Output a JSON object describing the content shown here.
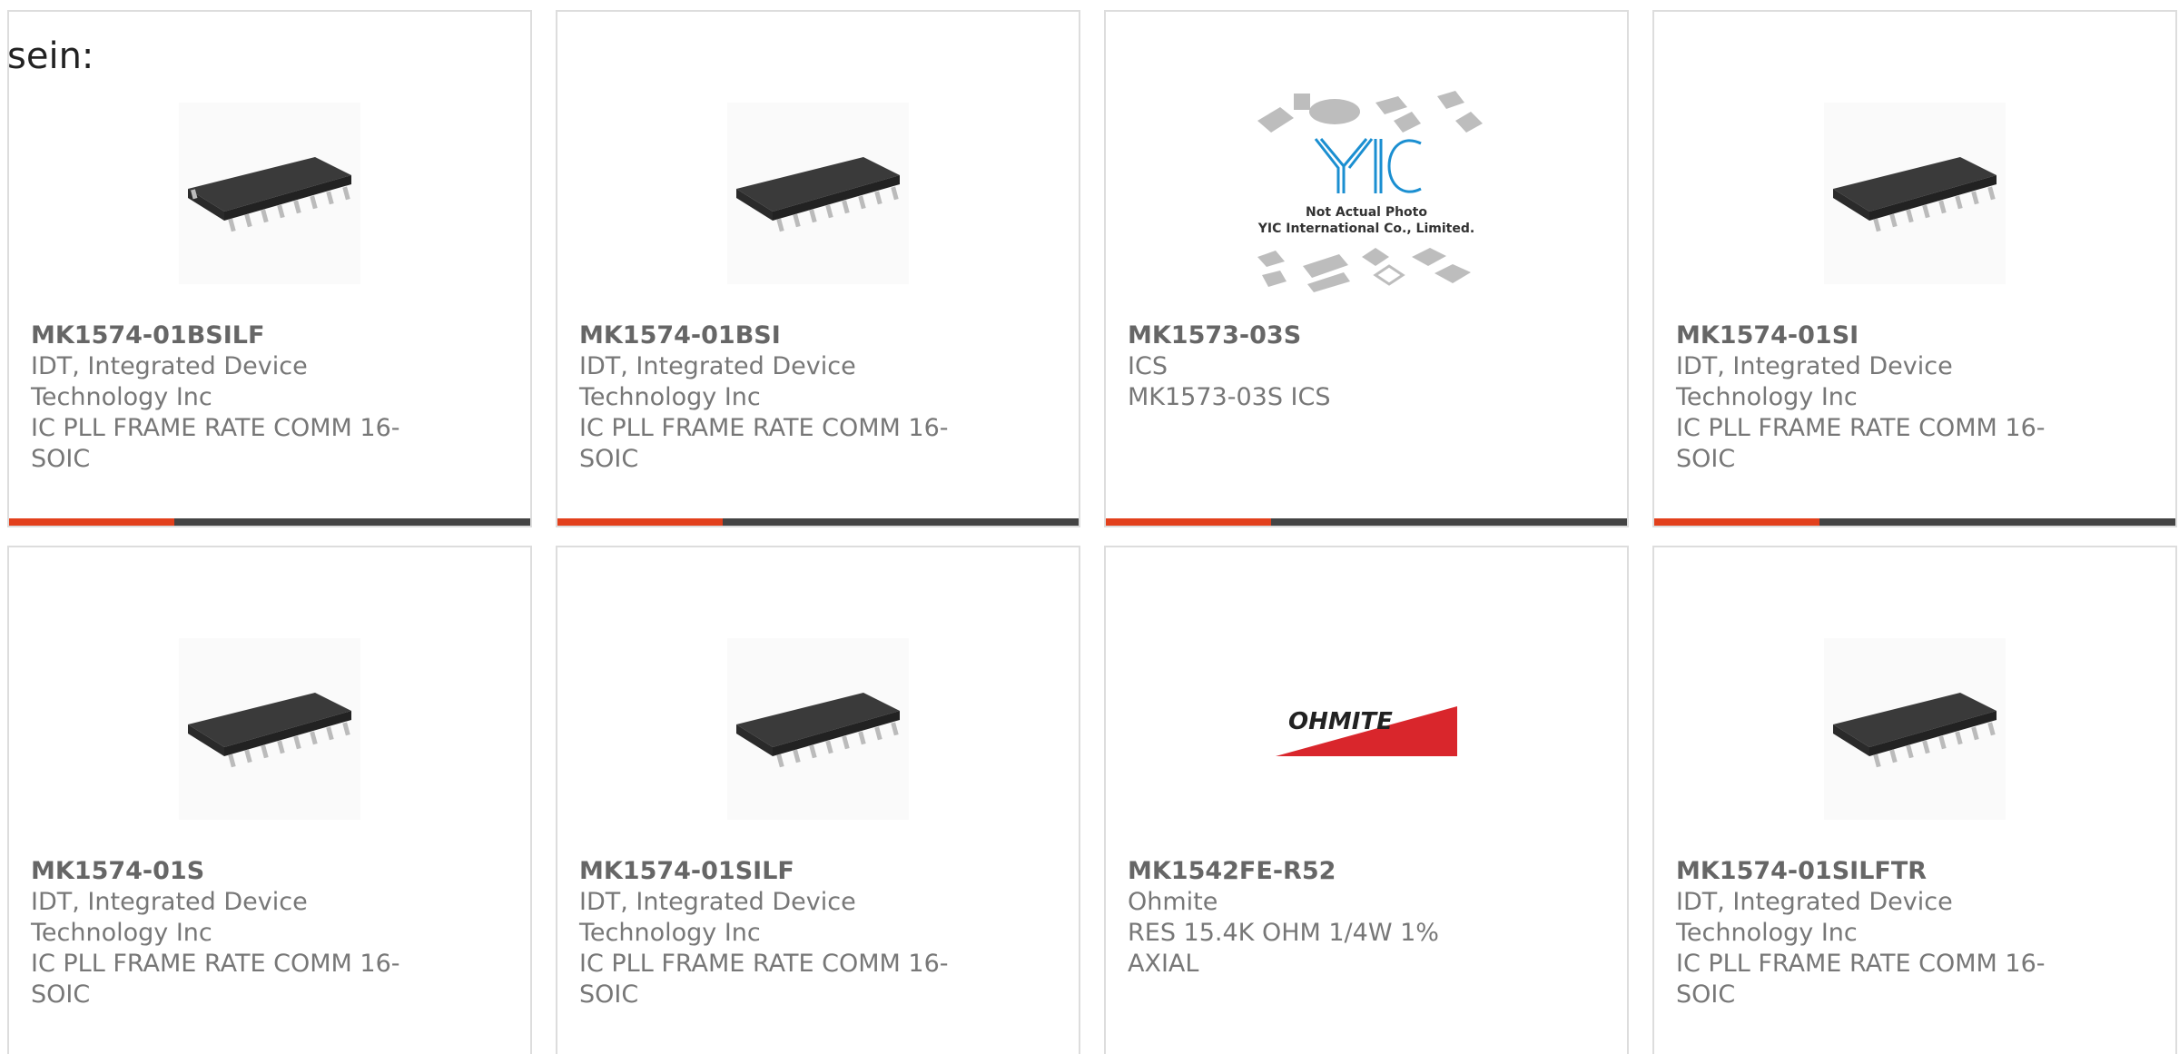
{
  "intro_text": "sein:",
  "cards": [
    {
      "title": "MK1574-01BSILF",
      "manufacturer": "IDT, Integrated Device Technology Inc",
      "description": "IC PLL FRAME RATE COMM 16-SOIC",
      "image": "ic-soic-16",
      "accent_color": "#e2401c"
    },
    {
      "title": "MK1574-01BSI",
      "manufacturer": "IDT, Integrated Device Technology Inc",
      "description": "IC PLL FRAME RATE COMM 16-SOIC",
      "image": "ic-soic-16",
      "accent_color": "#e2401c"
    },
    {
      "title": "MK1573-03S",
      "manufacturer": "ICS",
      "description": "MK1573-03S ICS",
      "image": "yic-not-actual-photo",
      "placeholder_line1": "Not Actual Photo",
      "placeholder_line2": "YIC International Co., Limited.",
      "placeholder_logo": "YIC",
      "accent_color": "#e2401c"
    },
    {
      "title": "MK1574-01SI",
      "manufacturer": "IDT, Integrated Device Technology Inc",
      "description": "IC PLL FRAME RATE COMM 16-SOIC",
      "image": "ic-soic-16",
      "accent_color": "#e2401c"
    },
    {
      "title": "MK1574-01S",
      "manufacturer": "IDT, Integrated Device Technology Inc",
      "description": "IC PLL FRAME RATE COMM 16-SOIC",
      "image": "ic-soic-16"
    },
    {
      "title": "MK1574-01SILF",
      "manufacturer": "IDT, Integrated Device Technology Inc",
      "description": "IC PLL FRAME RATE COMM 16-SOIC",
      "image": "ic-soic-16"
    },
    {
      "title": "MK1542FE-R52",
      "manufacturer": "Ohmite",
      "description": "RES 15.4K OHM 1/4W 1% AXIAL",
      "image": "ohmite-logo",
      "logo_text": "OHMITE"
    },
    {
      "title": "MK1574-01SILFTR",
      "manufacturer": "IDT, Integrated Device Technology Inc",
      "description": "IC PLL FRAME RATE COMM 16-SOIC",
      "image": "ic-soic-16"
    }
  ],
  "colors": {
    "accent": "#e2401c",
    "bar": "#444444",
    "border": "#dddddd",
    "title": "#666666",
    "text": "#777777"
  }
}
